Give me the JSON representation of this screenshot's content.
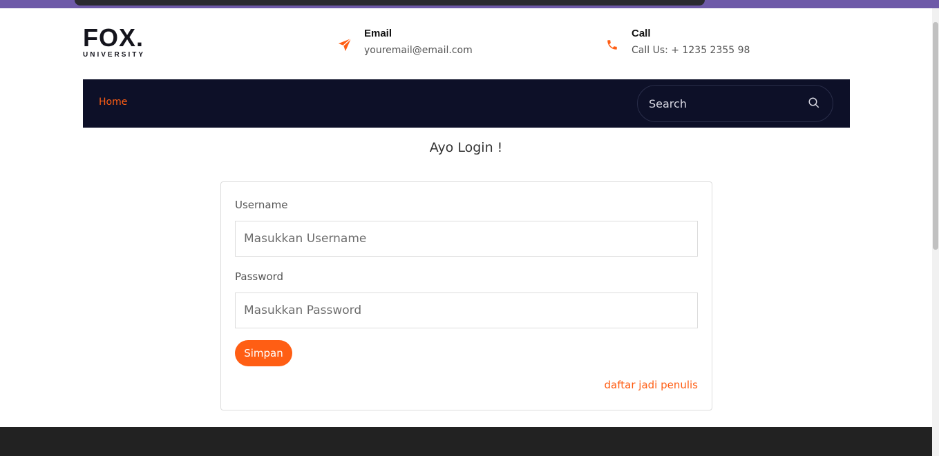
{
  "brand": {
    "name": "FOX.",
    "subtitle": "UNIVERSITY"
  },
  "contact": {
    "email": {
      "title": "Email",
      "value": "youremail@email.com",
      "icon": "paper-plane-icon"
    },
    "call": {
      "title": "Call",
      "value": "Call Us: + 1235 2355 98",
      "icon": "phone-icon"
    }
  },
  "nav": {
    "items": [
      {
        "label": "Home",
        "active": true
      }
    ],
    "search": {
      "placeholder": "Search",
      "icon": "search-icon"
    }
  },
  "login": {
    "heading": "Ayo Login !",
    "username_label": "Username",
    "username_placeholder": "Masukkan Username",
    "password_label": "Password",
    "password_placeholder": "Masukkan Password",
    "submit_label": "Simpan",
    "register_link": "daftar jadi penulis"
  },
  "colors": {
    "accent": "#ff5e14",
    "navbar": "#0d1028",
    "footer": "#222222"
  }
}
